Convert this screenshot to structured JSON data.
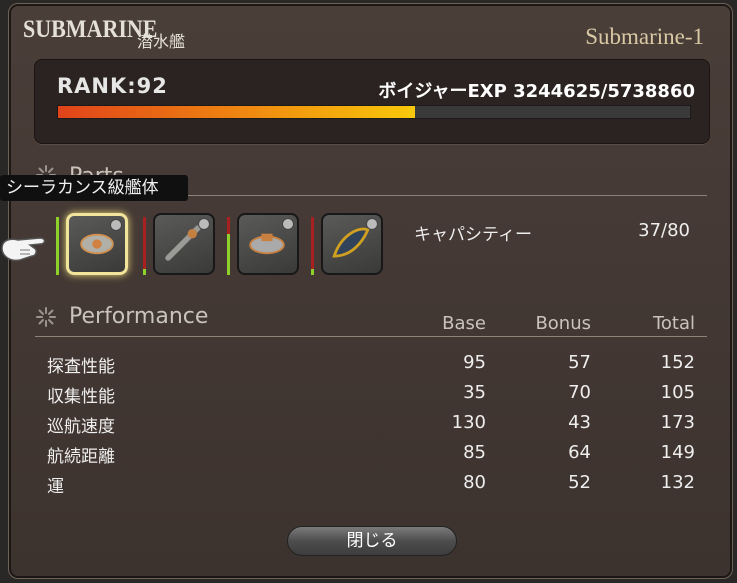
{
  "window": {
    "title": "SUBMARINE",
    "title_jp": "潜水艦",
    "name": "Submarine-1"
  },
  "rank": {
    "label": "RANK:92",
    "exp_text": "ボイジャーEXP 3244625/5738860",
    "exp_progress": 0.565
  },
  "parts": {
    "heading": "Parts",
    "tooltip": "シーラカンス級艦体",
    "items": [
      {
        "name": "hull-part",
        "icon": "hull-icon",
        "condition": 0.2
      },
      {
        "name": "stern-part",
        "icon": "stern-icon",
        "condition": 0.1
      },
      {
        "name": "bow-part",
        "icon": "bow-icon",
        "condition": 0.7
      },
      {
        "name": "bridge-part",
        "icon": "bridge-icon",
        "condition": 0.1
      }
    ],
    "capacity_label": "キャパシティー",
    "capacity_value": "37/80"
  },
  "performance": {
    "heading": "Performance",
    "columns": [
      "Base",
      "Bonus",
      "Total"
    ],
    "rows": [
      {
        "label": "探査性能",
        "base": "95",
        "bonus": "57",
        "total": "152"
      },
      {
        "label": "収集性能",
        "base": "35",
        "bonus": "70",
        "total": "105"
      },
      {
        "label": "巡航速度",
        "base": "130",
        "bonus": "43",
        "total": "173"
      },
      {
        "label": "航続距離",
        "base": "85",
        "bonus": "64",
        "total": "149"
      },
      {
        "label": "運",
        "base": "80",
        "bonus": "52",
        "total": "132"
      }
    ]
  },
  "close_button": "閉じる",
  "colors": {
    "accent_gold": "#f2e49a",
    "exp_fill_start": "#e0431a",
    "exp_fill_end": "#f8c80a",
    "condition_green": "#8ed12a",
    "condition_red": "#a82020"
  }
}
